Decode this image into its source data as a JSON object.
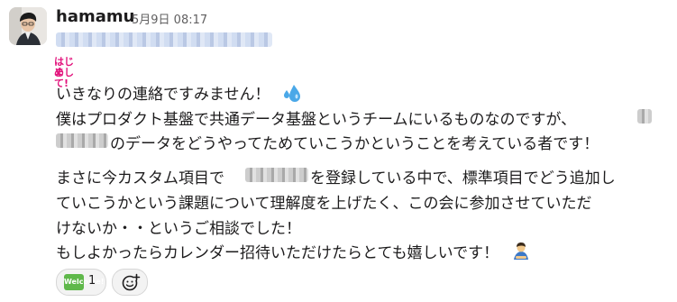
{
  "message": {
    "author": "hamamu",
    "timestamp": "5月9日 08:17",
    "title_emoji_text": "はじめ まして!",
    "lines": [
      "いきなりの連絡ですみません！",
      "僕はプロダクト基盤で共通データ基盤というチームにいるものなのですが、",
      "のデータをどうやってためていこうかということを考えている者です！",
      "まさに今カスタム項目で",
      "を登録している中で、標準項目でどう追加し",
      "ていこうかという課題について理解度を上げたく、この会に参加させていただ",
      "けないか・・というご相談でした！",
      "もしよかったらカレンダー招待いただけたらとても嬉しいです！"
    ]
  },
  "reactions": [
    {
      "emoji": "welcome-emoji",
      "label": "Welcome!",
      "count": "1"
    }
  ],
  "icons": {
    "sweat": "sweat-drops-icon",
    "person": "person-bowing-icon",
    "add": "add-reaction-icon"
  },
  "colors": {
    "accent": "#1264a3",
    "reaction_bg": "#f3f3f3"
  }
}
